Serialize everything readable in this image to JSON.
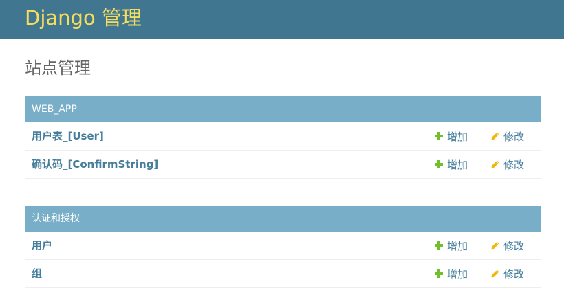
{
  "header": {
    "branding": "Django 管理"
  },
  "page": {
    "title": "站点管理"
  },
  "modules": [
    {
      "caption": "WEB_APP",
      "models": [
        {
          "name": "用户表_[User]",
          "add_label": "增加",
          "change_label": "修改"
        },
        {
          "name": "确认码_[ConfirmString]",
          "add_label": "增加",
          "change_label": "修改"
        }
      ]
    },
    {
      "caption": "认证和授权",
      "models": [
        {
          "name": "用户",
          "add_label": "增加",
          "change_label": "修改"
        },
        {
          "name": "组",
          "add_label": "增加",
          "change_label": "修改"
        }
      ]
    }
  ],
  "icons": {
    "add": "plus-icon",
    "change": "pencil-icon"
  },
  "colors": {
    "header_bg": "#417690",
    "branding": "#f5dd5d",
    "caption_bg": "#79aec8",
    "link": "#447e9b",
    "add_icon": "#70bf2b",
    "change_icon": "#efb80b"
  }
}
